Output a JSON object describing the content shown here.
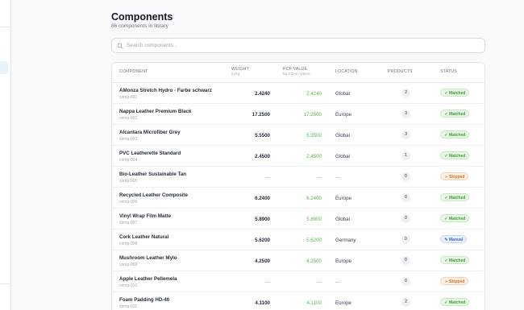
{
  "page": {
    "title": "Components",
    "subtitle": "86 components in library"
  },
  "search": {
    "placeholder": "Search components..."
  },
  "table": {
    "headers": {
      "component": "COMPONENT",
      "weight": "WEIGHT",
      "weight_unit": "in kg",
      "pcf": "PCF VALUE",
      "pcf_unit": "kg CO₂e / piece",
      "location": "LOCATION",
      "products": "PRODUCTS",
      "status": "STATUS"
    },
    "rows": [
      {
        "name": "AMonza Stretch Hydro - Farbe schwarz",
        "code": "comp-001",
        "weight": "2.4240",
        "pcf": "2.4240",
        "location": "Global",
        "products": "2",
        "status": "Matched"
      },
      {
        "name": "Nappa Leather Premium Black",
        "code": "comp-002",
        "weight": "17.2500",
        "pcf": "17.2500",
        "location": "Europe",
        "products": "3",
        "status": "Matched"
      },
      {
        "name": "Alcantara Microfiber Grey",
        "code": "comp-003",
        "weight": "5.5500",
        "pcf": "5.5500",
        "location": "Global",
        "products": "3",
        "status": "Matched"
      },
      {
        "name": "PVC Leatherette Standard",
        "code": "comp-004",
        "weight": "2.4500",
        "pcf": "2.4500",
        "location": "Global",
        "products": "1",
        "status": "Matched"
      },
      {
        "name": "Bio-Leather Sustainable Tan",
        "code": "comp-005",
        "weight": "—",
        "pcf": "—",
        "location": "—",
        "products": "0",
        "status": "Skipped"
      },
      {
        "name": "Recycled Leather Composite",
        "code": "comp-006",
        "weight": "6.2400",
        "pcf": "6.2400",
        "location": "Europe",
        "products": "0",
        "status": "Matched"
      },
      {
        "name": "Vinyl Wrap Film Matte",
        "code": "comp-007",
        "weight": "5.8900",
        "pcf": "5.8900",
        "location": "Global",
        "products": "0",
        "status": "Matched"
      },
      {
        "name": "Cork Leather Natural",
        "code": "comp-008",
        "weight": "5.6200",
        "pcf": "5.6200",
        "location": "Germany",
        "products": "0",
        "status": "Manual"
      },
      {
        "name": "Mushroom Leather Mylo",
        "code": "comp-009",
        "weight": "4.2500",
        "pcf": "4.2500",
        "location": "Europe",
        "products": "0",
        "status": "Matched"
      },
      {
        "name": "Apple Leather Pellemela",
        "code": "comp-010",
        "weight": "—",
        "pcf": "—",
        "location": "—",
        "products": "0",
        "status": "Skipped"
      },
      {
        "name": "Foam Padding HD-40",
        "code": "comp-011",
        "weight": "4.1100",
        "pcf": "4.1100",
        "location": "Europe",
        "products": "2",
        "status": "Matched"
      }
    ]
  },
  "status_colors": {
    "Matched": "#3f9b3a",
    "Skipped": "#d2732d",
    "Manual": "#4169c9"
  },
  "status_icons": {
    "Matched": "check-circle-icon",
    "Skipped": "skip-icon",
    "Manual": "pencil-icon"
  }
}
